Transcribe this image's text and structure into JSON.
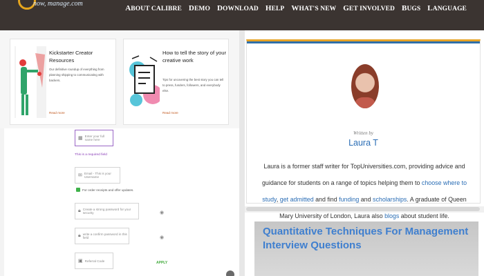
{
  "nav": {
    "logo_text": "now, manage.com",
    "links": [
      "About Calibre",
      "Demo",
      "Download",
      "Help",
      "What's New",
      "Get Involved",
      "Bugs",
      "Language"
    ]
  },
  "resources": [
    {
      "title": "Kickstarter Creator Resources",
      "description": "Our definitive roundup of everything from planning shipping to communicating with backers.",
      "read_more": "Read more"
    },
    {
      "title": "How to tell the story of your creative work",
      "description": "Tips for uncovering the best story you can tell to press, funders, followers, and everybody else.",
      "read_more": "Read more"
    }
  ],
  "form": {
    "name_placeholder": "Enter your full name here",
    "required_note": "This is a required field",
    "email_placeholder": "Email - This is your Username",
    "optin_label": "For order receipts and offer updates.",
    "password_placeholder": "Create a strong password for your security",
    "confirm_placeholder": "write a confirm password in this field",
    "referral_placeholder": "Referral Code",
    "apply_label": "APPLY"
  },
  "author": {
    "written_by": "Written by",
    "name": "Laura T",
    "bio_1": "Laura is a former staff writer for TopUniversities.com, providing advice and guidance for students on a range of topics helping them to ",
    "link_choose": "choose where to study",
    "bio_2": ", ",
    "link_admitted": "get admitted",
    "bio_3": " and find ",
    "link_funding": "funding",
    "bio_4": " and ",
    "link_scholarships": "scholarships",
    "bio_5": ". A graduate of Queen Mary University of London, Laura also ",
    "link_blogs": "blogs",
    "bio_6": " about student life."
  },
  "article": {
    "image_title": "Quantitative Techniques For Management Interview Questions"
  }
}
